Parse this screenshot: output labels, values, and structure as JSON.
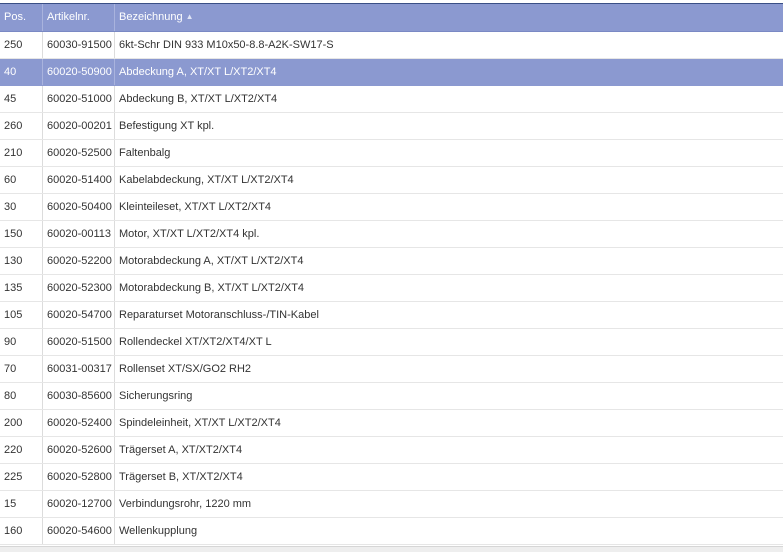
{
  "table": {
    "headers": {
      "pos": "Pos.",
      "artikelnr": "Artikelnr.",
      "bezeichnung": "Bezeichnung"
    },
    "sort_indicator": "▲",
    "selected_row": 1,
    "rows": [
      {
        "pos": "250",
        "artikelnr": "60030-91500",
        "bezeichnung": "6kt-Schr DIN 933 M10x50-8.8-A2K-SW17-S"
      },
      {
        "pos": "40",
        "artikelnr": "60020-50900",
        "bezeichnung": "Abdeckung A, XT/XT L/XT2/XT4"
      },
      {
        "pos": "45",
        "artikelnr": "60020-51000",
        "bezeichnung": "Abdeckung B, XT/XT L/XT2/XT4"
      },
      {
        "pos": "260",
        "artikelnr": "60020-00201",
        "bezeichnung": "Befestigung XT kpl."
      },
      {
        "pos": "210",
        "artikelnr": "60020-52500",
        "bezeichnung": "Faltenbalg"
      },
      {
        "pos": "60",
        "artikelnr": "60020-51400",
        "bezeichnung": "Kabelabdeckung, XT/XT L/XT2/XT4"
      },
      {
        "pos": "30",
        "artikelnr": "60020-50400",
        "bezeichnung": "Kleinteileset, XT/XT L/XT2/XT4"
      },
      {
        "pos": "150",
        "artikelnr": "60020-00113",
        "bezeichnung": "Motor, XT/XT L/XT2/XT4 kpl."
      },
      {
        "pos": "130",
        "artikelnr": "60020-52200",
        "bezeichnung": "Motorabdeckung A, XT/XT L/XT2/XT4"
      },
      {
        "pos": "135",
        "artikelnr": "60020-52300",
        "bezeichnung": "Motorabdeckung B, XT/XT L/XT2/XT4"
      },
      {
        "pos": "105",
        "artikelnr": "60020-54700",
        "bezeichnung": "Reparaturset Motoranschluss-/TIN-Kabel"
      },
      {
        "pos": "90",
        "artikelnr": "60020-51500",
        "bezeichnung": "Rollendeckel XT/XT2/XT4/XT L"
      },
      {
        "pos": "70",
        "artikelnr": "60031-00317",
        "bezeichnung": "Rollenset XT/SX/GO2 RH2"
      },
      {
        "pos": "80",
        "artikelnr": "60030-85600",
        "bezeichnung": "Sicherungsring"
      },
      {
        "pos": "200",
        "artikelnr": "60020-52400",
        "bezeichnung": "Spindeleinheit, XT/XT L/XT2/XT4"
      },
      {
        "pos": "220",
        "artikelnr": "60020-52600",
        "bezeichnung": "Trägerset A, XT/XT2/XT4"
      },
      {
        "pos": "225",
        "artikelnr": "60020-52800",
        "bezeichnung": "Trägerset B, XT/XT2/XT4"
      },
      {
        "pos": "15",
        "artikelnr": "60020-12700",
        "bezeichnung": "Verbindungsrohr, 1220 mm"
      },
      {
        "pos": "160",
        "artikelnr": "60020-54600",
        "bezeichnung": "Wellenkupplung"
      }
    ]
  },
  "colors": {
    "header_bg": "#8b99d0",
    "selected_bg": "#8b99d0",
    "header_text": "#ffffff"
  }
}
